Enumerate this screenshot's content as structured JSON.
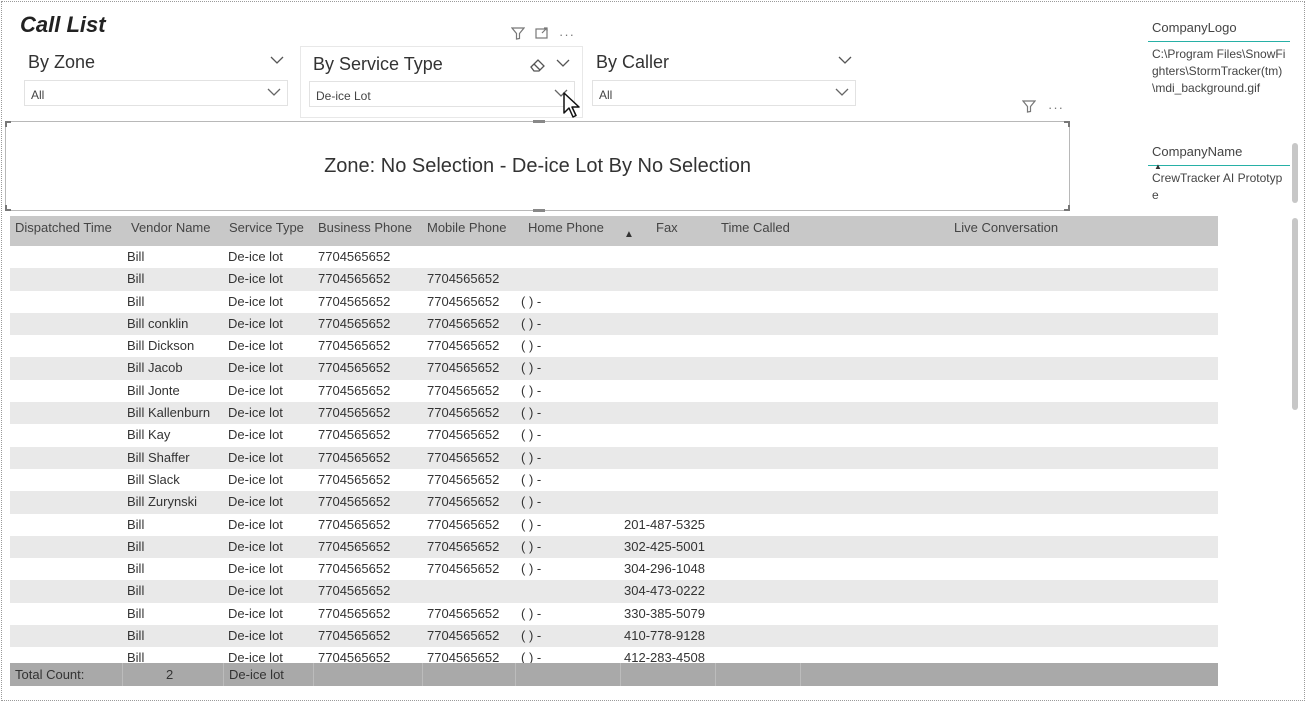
{
  "title": "Call List",
  "slicers": [
    {
      "label": "By Zone",
      "value": "All"
    },
    {
      "label": "By Service Type",
      "value": "De-ice Lot"
    },
    {
      "label": "By Caller",
      "value": "All"
    }
  ],
  "card_text": "Zone: No Selection - De-ice Lot By No Selection",
  "columns": [
    "Dispatched Time",
    "Vendor Name",
    "Service Type",
    "Business Phone",
    "Mobile Phone",
    "Home Phone",
    "Fax",
    "Time Called",
    "Live Conversation"
  ],
  "rows": [
    {
      "vendor": "Bill",
      "service": "De-ice lot",
      "business": "7704565652",
      "mobile": "",
      "home": "",
      "fax": ""
    },
    {
      "vendor": "Bill",
      "service": "De-ice lot",
      "business": "7704565652",
      "mobile": "7704565652",
      "home": "",
      "fax": ""
    },
    {
      "vendor": "Bill",
      "service": "De-ice lot",
      "business": "7704565652",
      "mobile": "7704565652",
      "home": "( ) -",
      "fax": ""
    },
    {
      "vendor": "Bill conklin",
      "service": "De-ice lot",
      "business": "7704565652",
      "mobile": "7704565652",
      "home": "( ) -",
      "fax": ""
    },
    {
      "vendor": "Bill Dickson",
      "service": "De-ice lot",
      "business": "7704565652",
      "mobile": "7704565652",
      "home": "( ) -",
      "fax": ""
    },
    {
      "vendor": "Bill Jacob",
      "service": "De-ice lot",
      "business": "7704565652",
      "mobile": "7704565652",
      "home": "( ) -",
      "fax": ""
    },
    {
      "vendor": "Bill Jonte",
      "service": "De-ice lot",
      "business": "7704565652",
      "mobile": "7704565652",
      "home": "( ) -",
      "fax": ""
    },
    {
      "vendor": "Bill Kallenburn",
      "service": "De-ice lot",
      "business": "7704565652",
      "mobile": "7704565652",
      "home": "( ) -",
      "fax": ""
    },
    {
      "vendor": "Bill Kay",
      "service": "De-ice lot",
      "business": "7704565652",
      "mobile": "7704565652",
      "home": "( ) -",
      "fax": ""
    },
    {
      "vendor": "Bill Shaffer",
      "service": "De-ice lot",
      "business": "7704565652",
      "mobile": "7704565652",
      "home": "( ) -",
      "fax": ""
    },
    {
      "vendor": "Bill Slack",
      "service": "De-ice lot",
      "business": "7704565652",
      "mobile": "7704565652",
      "home": "( ) -",
      "fax": ""
    },
    {
      "vendor": "Bill Zurynski",
      "service": "De-ice lot",
      "business": "7704565652",
      "mobile": "7704565652",
      "home": "( ) -",
      "fax": ""
    },
    {
      "vendor": "Bill",
      "service": "De-ice lot",
      "business": "7704565652",
      "mobile": "7704565652",
      "home": "( ) -",
      "fax": "201-487-5325"
    },
    {
      "vendor": "Bill",
      "service": "De-ice lot",
      "business": "7704565652",
      "mobile": "7704565652",
      "home": "( ) -",
      "fax": "302-425-5001"
    },
    {
      "vendor": "Bill",
      "service": "De-ice lot",
      "business": "7704565652",
      "mobile": "7704565652",
      "home": "( ) -",
      "fax": "304-296-1048"
    },
    {
      "vendor": "Bill",
      "service": "De-ice lot",
      "business": "7704565652",
      "mobile": "",
      "home": "",
      "fax": "304-473-0222"
    },
    {
      "vendor": "Bill",
      "service": "De-ice lot",
      "business": "7704565652",
      "mobile": "7704565652",
      "home": "( ) -",
      "fax": "330-385-5079"
    },
    {
      "vendor": "Bill",
      "service": "De-ice lot",
      "business": "7704565652",
      "mobile": "7704565652",
      "home": "( ) -",
      "fax": "410-778-9128"
    },
    {
      "vendor": "Bill",
      "service": "De-ice lot",
      "business": "7704565652",
      "mobile": "7704565652",
      "home": "( ) -",
      "fax": "412-283-4508"
    }
  ],
  "footer": {
    "label": "Total Count:",
    "count": "2",
    "service": "De-ice lot"
  },
  "side": {
    "logo_header": "CompanyLogo",
    "logo_value": "C:\\Program Files\\SnowFighters\\StormTracker(tm)\\mdi_background.gif",
    "name_header": "CompanyName",
    "name_value": "CrewTracker AI Prototype"
  },
  "icons": [
    "filter-icon",
    "focus-mode-icon",
    "more-options-icon",
    "chevron-down-icon",
    "eraser-icon",
    "sort-ascending-icon",
    "pointer-cursor-icon"
  ]
}
